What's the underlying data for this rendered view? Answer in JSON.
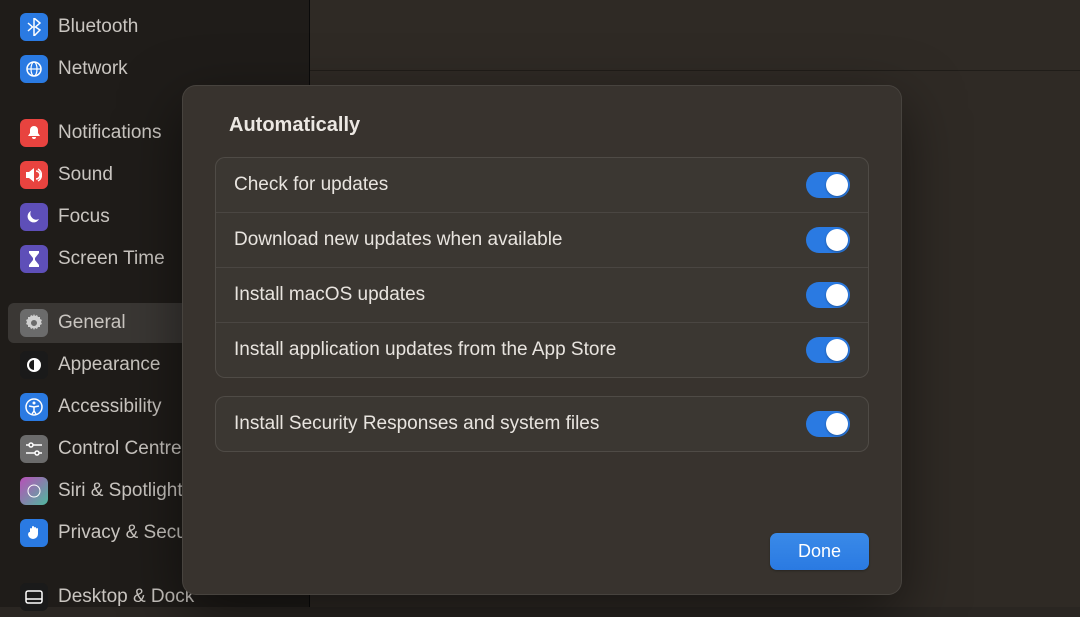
{
  "sidebar": {
    "items": [
      {
        "label": "Bluetooth",
        "icon": "bluetooth"
      },
      {
        "label": "Network",
        "icon": "network"
      },
      {
        "label": "Notifications",
        "icon": "notifications"
      },
      {
        "label": "Sound",
        "icon": "sound"
      },
      {
        "label": "Focus",
        "icon": "focus"
      },
      {
        "label": "Screen Time",
        "icon": "screentime"
      },
      {
        "label": "General",
        "icon": "general"
      },
      {
        "label": "Appearance",
        "icon": "appearance"
      },
      {
        "label": "Accessibility",
        "icon": "accessibility"
      },
      {
        "label": "Control Centre",
        "icon": "control"
      },
      {
        "label": "Siri & Spotlight",
        "icon": "siri"
      },
      {
        "label": "Privacy & Security",
        "icon": "privacy"
      },
      {
        "label": "Desktop & Dock",
        "icon": "desktop"
      }
    ],
    "selected_index": 6
  },
  "modal": {
    "title": "Automatically",
    "group1": [
      {
        "label": "Check for updates",
        "on": true
      },
      {
        "label": "Download new updates when available",
        "on": true
      },
      {
        "label": "Install macOS updates",
        "on": true
      },
      {
        "label": "Install application updates from the App Store",
        "on": true
      }
    ],
    "group2": [
      {
        "label": "Install Security Responses and system files",
        "on": true
      }
    ],
    "done_label": "Done"
  }
}
